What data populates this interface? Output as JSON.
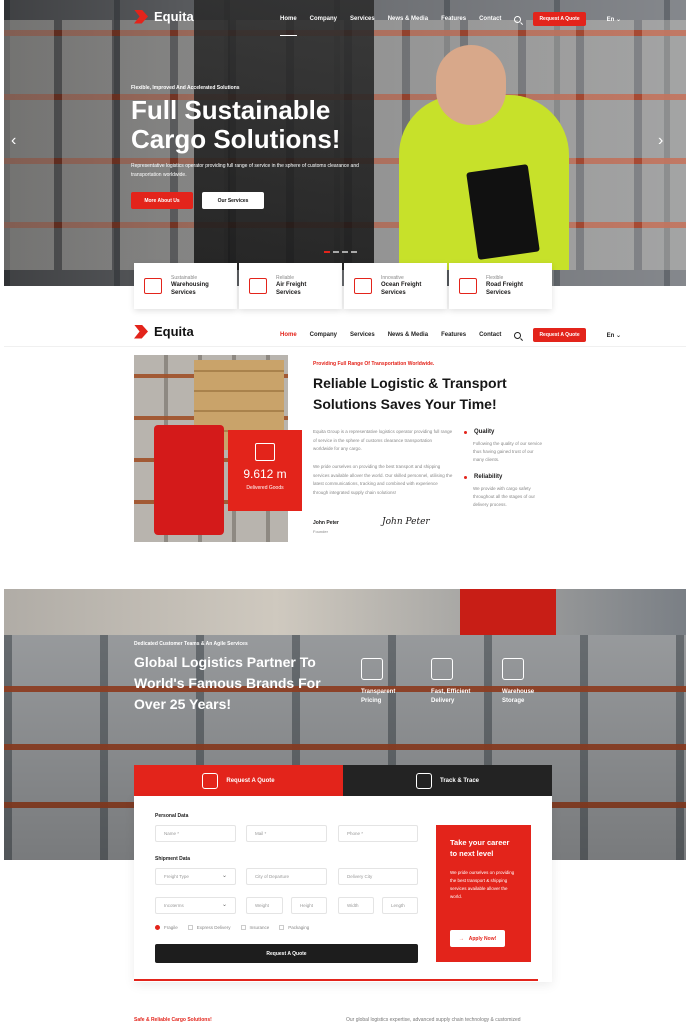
{
  "brand": {
    "name": "Equita",
    "accent": "#e3241b",
    "dark": "#1d1d1d"
  },
  "nav": {
    "items": [
      "Home",
      "Company",
      "Services",
      "News & Media",
      "Features",
      "Contact"
    ],
    "cta": "Request A Quote",
    "lang": "En ⌄",
    "search_icon": "search-icon"
  },
  "hero": {
    "eyebrow": "Flexible, Improved And Accelerated Solutions",
    "title": "Full Sustainable Cargo Solutions!",
    "description": "Representative logistics operator providing full range of service in the sphere of customs clearance and transportation worldwide.",
    "primary_button": "More About Us",
    "secondary_button": "Our Services",
    "prev": "‹",
    "next": "›",
    "slides": 4,
    "active_slide": 1
  },
  "features": [
    {
      "small": "Sustainable",
      "title": "Warehousing Services",
      "icon": "warehouse-icon"
    },
    {
      "small": "Reliable",
      "title": "Air Freight Services",
      "icon": "airplane-icon"
    },
    {
      "small": "Innovative",
      "title": "Ocean Freight Services",
      "icon": "ship-icon"
    },
    {
      "small": "Flexible",
      "title": "Road Freight Services",
      "icon": "truck-icon"
    }
  ],
  "about": {
    "eyebrow": "Providing Full Range Of Transportation Worldwide.",
    "title": "Reliable Logistic & Transport Solutions Saves Your Time!",
    "p1": "Equita Group is a representative logistics operator providing full range of service in the sphere of customs clearance transportation worldwide for any cargo.",
    "p2": "We pride ourselves on providing the best transport and shipping services available allover the world. Our skilled personnel, utilising the latest communications, tracking and combined with experience through integrated supply chain solutions!",
    "stat_value": "9.612 m",
    "stat_label": "Delivered Goods",
    "quality_title": "Quality",
    "quality_text": "Following the quality of our service thus having gained trust of our many clients.",
    "reliability_title": "Reliability",
    "reliability_text": "We provide with cargo safety throughout all the stages of our delivery process.",
    "signer_name": "John Peter",
    "signer_role": "Founder",
    "signature": "John Peter"
  },
  "logistics": {
    "eyebrow": "Dedicated Customer Teams & An Agile Services",
    "title": "Global Logistics Partner To World's Famous Brands For Over 25 Years!",
    "services": [
      {
        "label": "Transparent Pricing",
        "icon": "pricing-icon"
      },
      {
        "label": "Fast, Efficient Delivery",
        "icon": "delivery-box-icon"
      },
      {
        "label": "Warehouse Storage",
        "icon": "scale-icon"
      }
    ]
  },
  "quote": {
    "tab_quote": "Request A Quote",
    "tab_track": "Track & Trace",
    "personal_label": "Personal Data",
    "shipment_label": "Shipment Data",
    "name_ph": "Name *",
    "mail_ph": "Mail *",
    "phone_ph": "Phone *",
    "freight_type": "Freight Type",
    "city_departure": "City of Departure",
    "delivery_city": "Delivery City",
    "incoterms": "Incoterms",
    "weight": "Weight",
    "height": "Height",
    "width": "Width",
    "length": "Length",
    "options": [
      "Fragile",
      "Express Delivery",
      "Insurance",
      "Packaging"
    ],
    "selected_option": "Fragile",
    "submit": "Request A Quote"
  },
  "career": {
    "title": "Take your career to next level",
    "text": "We pride ourselves on providing the best transport & shipping services available allover the world.",
    "button": "Apply Now!"
  },
  "footer_peek": {
    "left": "Safe & Reliable Cargo Solutions!",
    "right": "Our global logistics expertise, advanced supply chain technology & customized"
  }
}
